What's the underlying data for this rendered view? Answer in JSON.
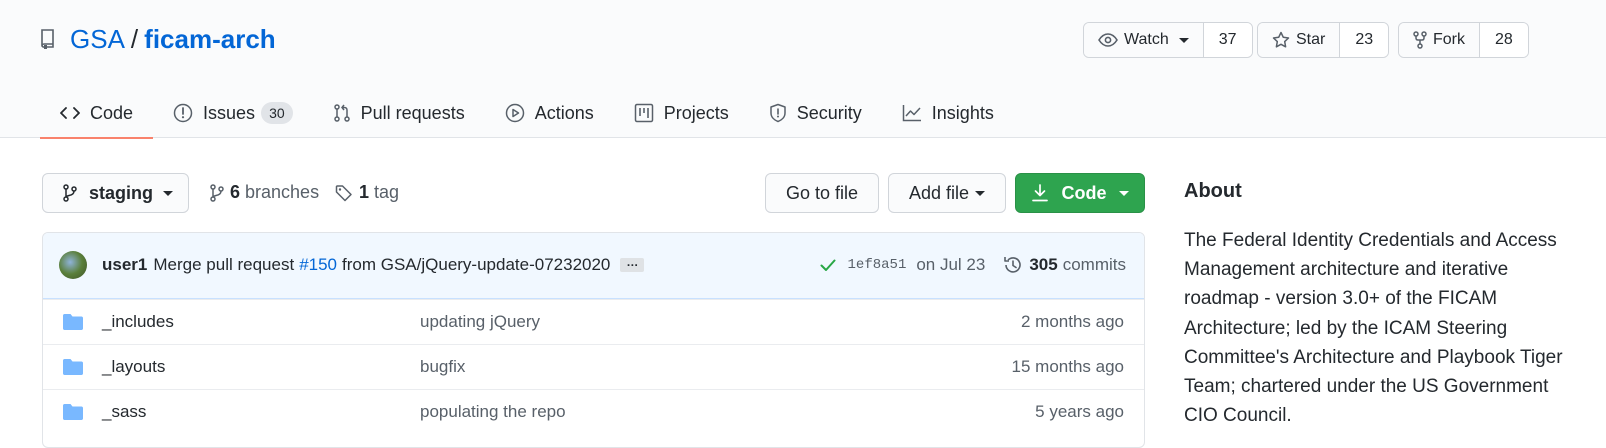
{
  "repo": {
    "owner": "GSA",
    "separator": "/",
    "name": "ficam-arch"
  },
  "actions": {
    "watch": {
      "label": "Watch",
      "count": "37"
    },
    "star": {
      "label": "Star",
      "count": "23"
    },
    "fork": {
      "label": "Fork",
      "count": "28"
    }
  },
  "nav": {
    "code": "Code",
    "issues": "Issues",
    "issues_count": "30",
    "pull_requests": "Pull requests",
    "actions": "Actions",
    "projects": "Projects",
    "security": "Security",
    "insights": "Insights"
  },
  "branch": {
    "current": "staging",
    "branches_count": "6",
    "branches_label": "branches",
    "tags_count": "1",
    "tags_label": "tag"
  },
  "buttons": {
    "go_to_file": "Go to file",
    "add_file": "Add file",
    "code": "Code"
  },
  "commit": {
    "author": "user1",
    "message_pre": "Merge pull request",
    "pr": "#150",
    "message_post": "from GSA/jQuery-update-07232020",
    "ellipsis": "…",
    "sha": "1ef8a51",
    "date": "on Jul 23",
    "commits_count": "305",
    "commits_label": "commits"
  },
  "files": [
    {
      "name": "_includes",
      "message": "updating jQuery",
      "age": "2 months ago"
    },
    {
      "name": "_layouts",
      "message": "bugfix",
      "age": "15 months ago"
    },
    {
      "name": "_sass",
      "message": "populating the repo",
      "age": "5 years ago"
    }
  ],
  "about": {
    "title": "About",
    "description": "The Federal Identity Credentials and Access Management architecture and iterative roadmap - version 3.0+ of the FICAM Architecture; led by the ICAM Steering Committee's Architecture and Playbook Tiger Team; chartered under the US Government CIO Council."
  },
  "colors": {
    "link": "#0366d6",
    "green": "#2ea44f",
    "tab_underline": "#f9826c",
    "commit_bg": "#f1f8ff",
    "folder": "#79b8ff"
  }
}
